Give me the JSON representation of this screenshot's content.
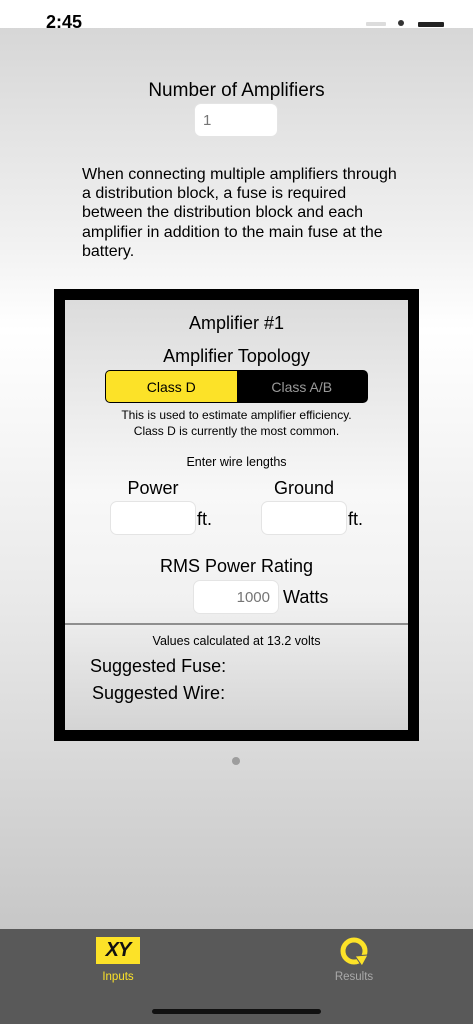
{
  "status_bar": {
    "time": "2:45"
  },
  "amplifier_count": {
    "label": "Number of Amplifiers",
    "placeholder": "1"
  },
  "info_text": "When connecting multiple amplifiers through a distribution block, a fuse is required between the distribution block and each amplifier in addition to the main fuse at the battery.",
  "amplifier": {
    "title": "Amplifier #1",
    "topology_label": "Amplifier Topology",
    "topology_options": [
      "Class D",
      "Class A/B"
    ],
    "topology_selected": "Class D",
    "efficiency_note_line1": "This is used to estimate amplifier efficiency.",
    "efficiency_note_line2": "Class D is currently the most common.",
    "wire_lengths_label": "Enter wire lengths",
    "power_label": "Power",
    "ground_label": "Ground",
    "power_value": "",
    "ground_value": "",
    "length_unit": "ft.",
    "rms_label": "RMS Power Rating",
    "rms_placeholder": "1000",
    "rms_unit": "Watts",
    "volts_note": "Values calculated at 13.2 volts",
    "suggested_fuse_label": "Suggested Fuse:",
    "suggested_wire_label": "Suggested Wire:"
  },
  "pager": {
    "pages": 1,
    "current": 1
  },
  "tab_bar": {
    "tabs": [
      {
        "label": "Inputs",
        "icon": "xy-icon",
        "icon_text": "XY",
        "active": true
      },
      {
        "label": "Results",
        "icon": "results-icon",
        "active": false
      }
    ],
    "active_color": "#fce228",
    "inactive_color": "#a9a9a9"
  },
  "colors": {
    "accent": "#fce228",
    "card_frame": "#000000",
    "tab_bar": "#595959"
  }
}
